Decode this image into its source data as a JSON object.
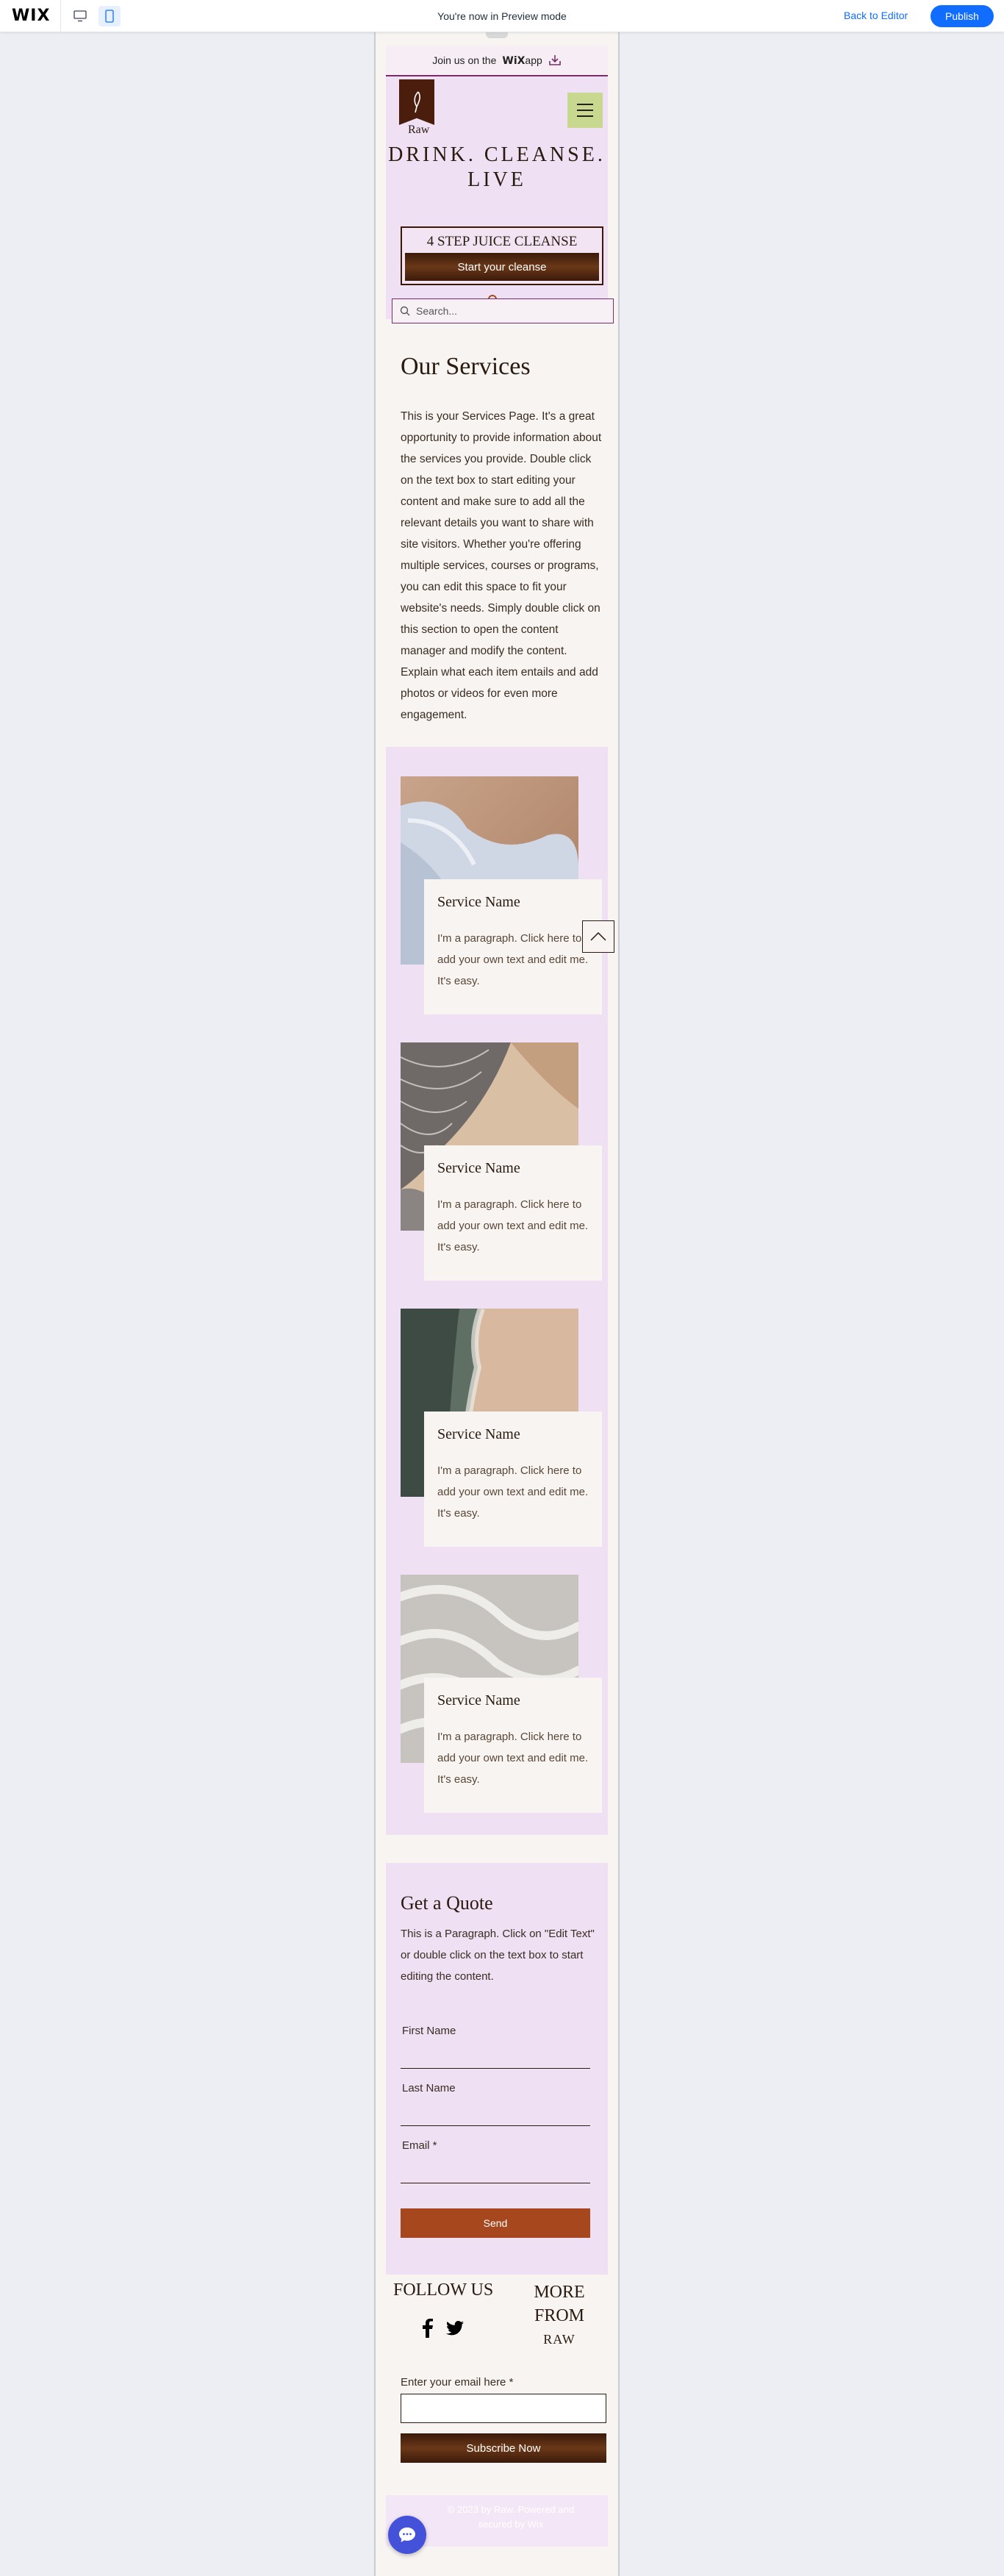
{
  "wix_bar": {
    "logo": "WIX",
    "preview_text": "You're now in Preview mode",
    "back_to_editor": "Back to Editor",
    "publish": "Publish",
    "accent": "#116dff"
  },
  "app_banner": {
    "prefix": "Join us on the",
    "brand": "WiX",
    "suffix": "app"
  },
  "header": {
    "logo_name": "Raw",
    "headline_line1": "DRINK. CLEANSE.",
    "headline_line2": "LIVE",
    "cleanse_title": "4 STEP JUICE CLEANSE",
    "cleanse_button": "Start your cleanse",
    "cart_count": "0",
    "search_placeholder": "Search..."
  },
  "services_intro": {
    "title": "Our Services",
    "body": "This is your Services Page. It's a great opportunity to provide information about the services you provide. Double click on the text box to start editing your content and make sure to add all the relevant details you want to share with site visitors. Whether you're offering multiple services, courses or programs, you can edit this space to fit your website's needs. Simply double click on this section to open the content manager and modify the content. Explain what each item entails and add photos or videos for even more engagement."
  },
  "services": [
    {
      "name": "Service Name",
      "description": "I'm a paragraph. Click here to add your own text and edit me. It's easy."
    },
    {
      "name": "Service Name",
      "description": "I'm a paragraph. Click here to add your own text and edit me. It's easy."
    },
    {
      "name": "Service Name",
      "description": "I'm a paragraph. Click here to add your own text and edit me. It's easy."
    },
    {
      "name": "Service Name",
      "description": "I'm a paragraph. Click here to add your own text and edit me. It's easy."
    }
  ],
  "quote": {
    "title": "Get a Quote",
    "body": "This is a Paragraph. Click on \"Edit Text\" or double click on the text box to start editing the content.",
    "fields": [
      "First Name",
      "Last Name",
      "Email *"
    ],
    "send": "Send"
  },
  "footer": {
    "follow_us": "FOLLOW US",
    "more_from_line1": "MORE",
    "more_from_line2": "FROM",
    "more_from_brand": "RAW",
    "email_label": "Enter your email here *",
    "subscribe": "Subscribe Now",
    "copyright": "© 2023 by Raw. Powered and secured by Wix"
  },
  "colors": {
    "pink": "#efe0f3",
    "cream": "#f7f4f1",
    "brown": "#3b1a0a",
    "rust": "#a6471e",
    "lime": "#c8d98f"
  }
}
